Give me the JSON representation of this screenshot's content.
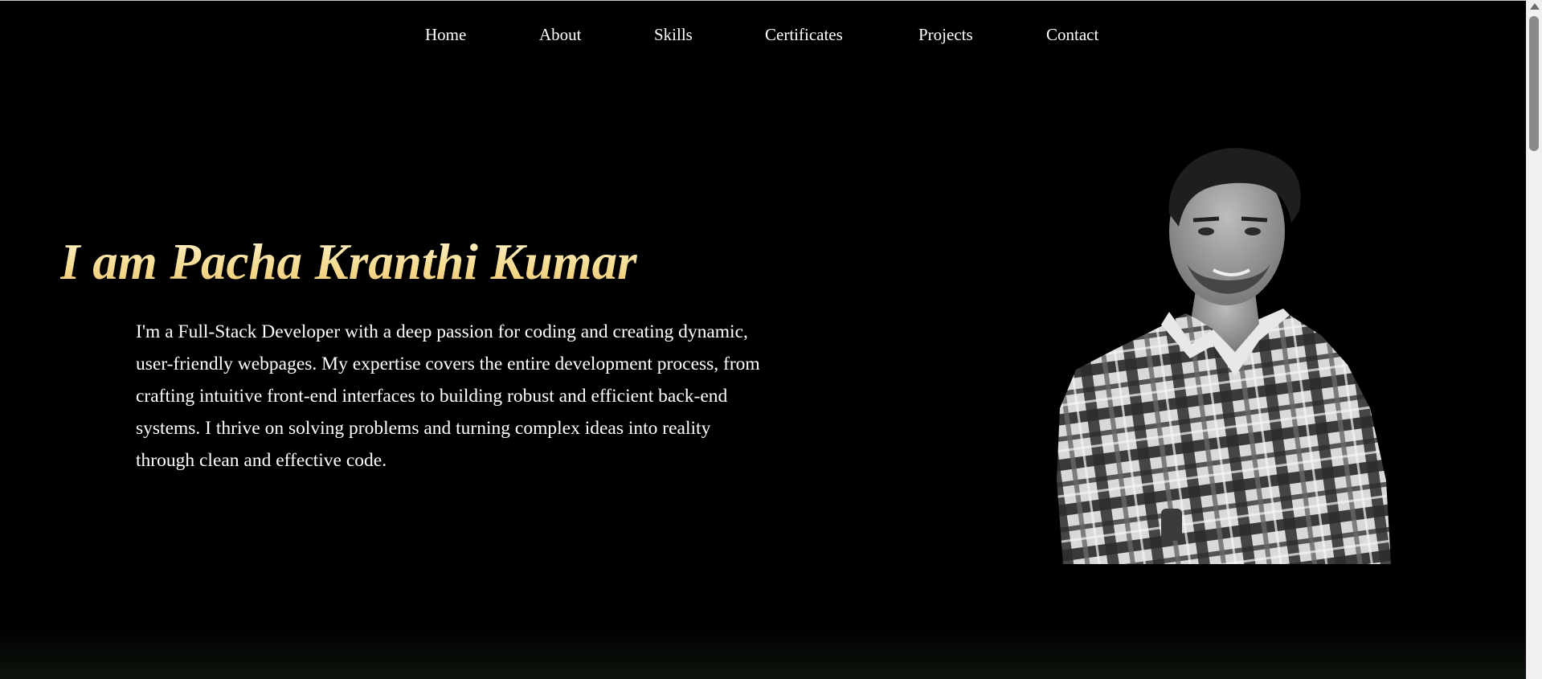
{
  "nav": {
    "items": [
      {
        "label": "Home"
      },
      {
        "label": "About"
      },
      {
        "label": "Skills"
      },
      {
        "label": "Certificates"
      },
      {
        "label": "Projects"
      },
      {
        "label": "Contact"
      }
    ]
  },
  "hero": {
    "title": "I am Pacha Kranthi Kumar",
    "description": "I'm a Full-Stack Developer with a deep passion for coding and creating dynamic, user-friendly webpages. My expertise covers the entire development process, from crafting intuitive front-end interfaces to building robust and efficient back-end systems. I thrive on solving problems and turning complex ideas into reality through clean and effective code.",
    "portrait_icon": "person-portrait-photo"
  },
  "colors": {
    "background": "#000000",
    "nav_text": "#ffffff",
    "title_gradient_start": "#fff6d8",
    "title_gradient_end": "#e9c36a",
    "body_text": "#ffffff"
  }
}
